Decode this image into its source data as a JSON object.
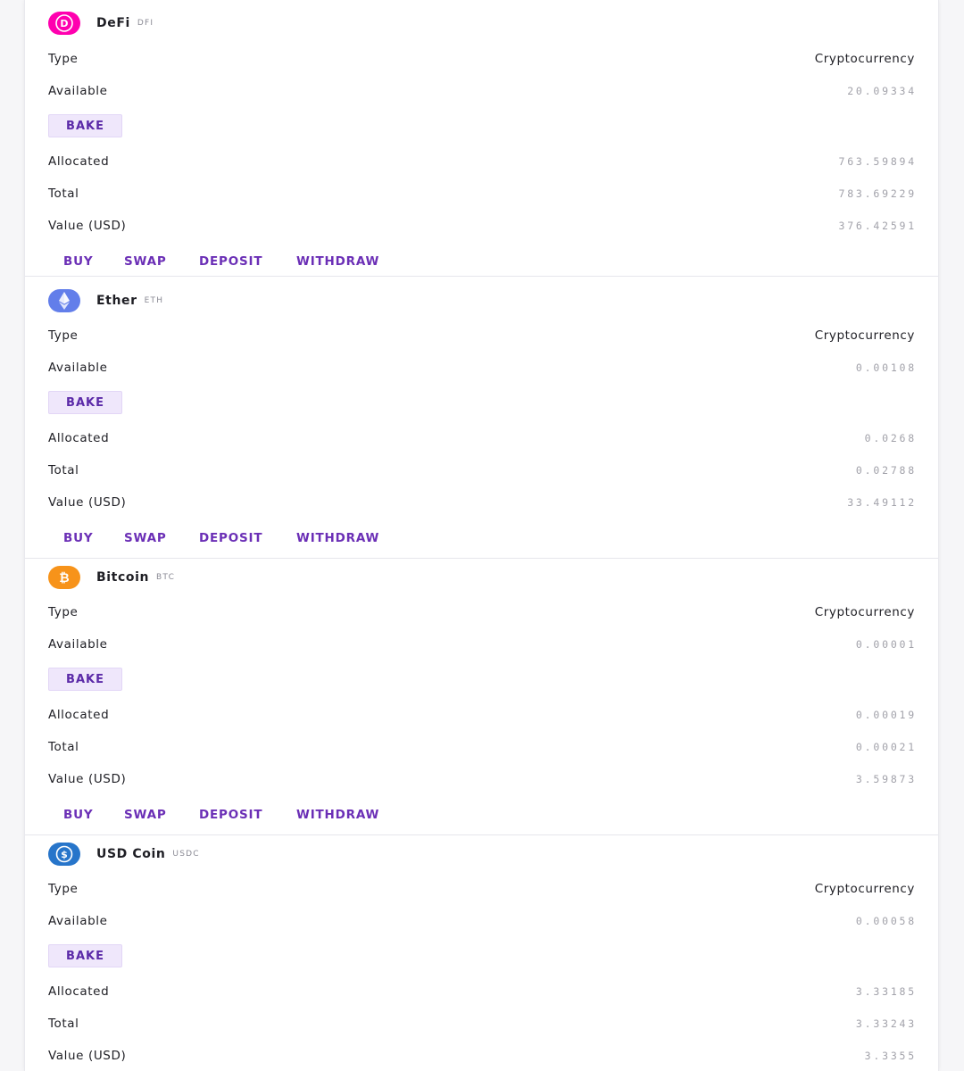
{
  "labels": {
    "type": "Type",
    "available": "Available",
    "bake": "BAKE",
    "allocated": "Allocated",
    "total": "Total",
    "value_usd": "Value (USD)",
    "buy": "BUY",
    "swap": "SWAP",
    "deposit": "DEPOSIT",
    "withdraw": "WITHDRAW"
  },
  "assets": [
    {
      "name": "DeFi",
      "ticker": "DFI",
      "icon": "defichain-icon",
      "icon_color": "#ff00af",
      "type": "Cryptocurrency",
      "available": "20.09334",
      "allocated": "763.59894",
      "total": "783.69229",
      "value_usd": "376.42591"
    },
    {
      "name": "Ether",
      "ticker": "ETH",
      "icon": "ethereum-icon",
      "icon_color": "#627eea",
      "type": "Cryptocurrency",
      "available": "0.00108",
      "allocated": "0.0268",
      "total": "0.02788",
      "value_usd": "33.49112"
    },
    {
      "name": "Bitcoin",
      "ticker": "BTC",
      "icon": "bitcoin-icon",
      "icon_color": "#f7931a",
      "type": "Cryptocurrency",
      "available": "0.00001",
      "allocated": "0.00019",
      "total": "0.00021",
      "value_usd": "3.59873"
    },
    {
      "name": "USD Coin",
      "ticker": "USDC",
      "icon": "usdc-icon",
      "icon_color": "#2775ca",
      "type": "Cryptocurrency",
      "available": "0.00058",
      "allocated": "3.33185",
      "total": "3.33243",
      "value_usd": "3.3355"
    }
  ],
  "colors": {
    "accent": "#6b2fb6",
    "bake_bg": "#efe7fb",
    "muted_value": "#a2a2aa"
  }
}
